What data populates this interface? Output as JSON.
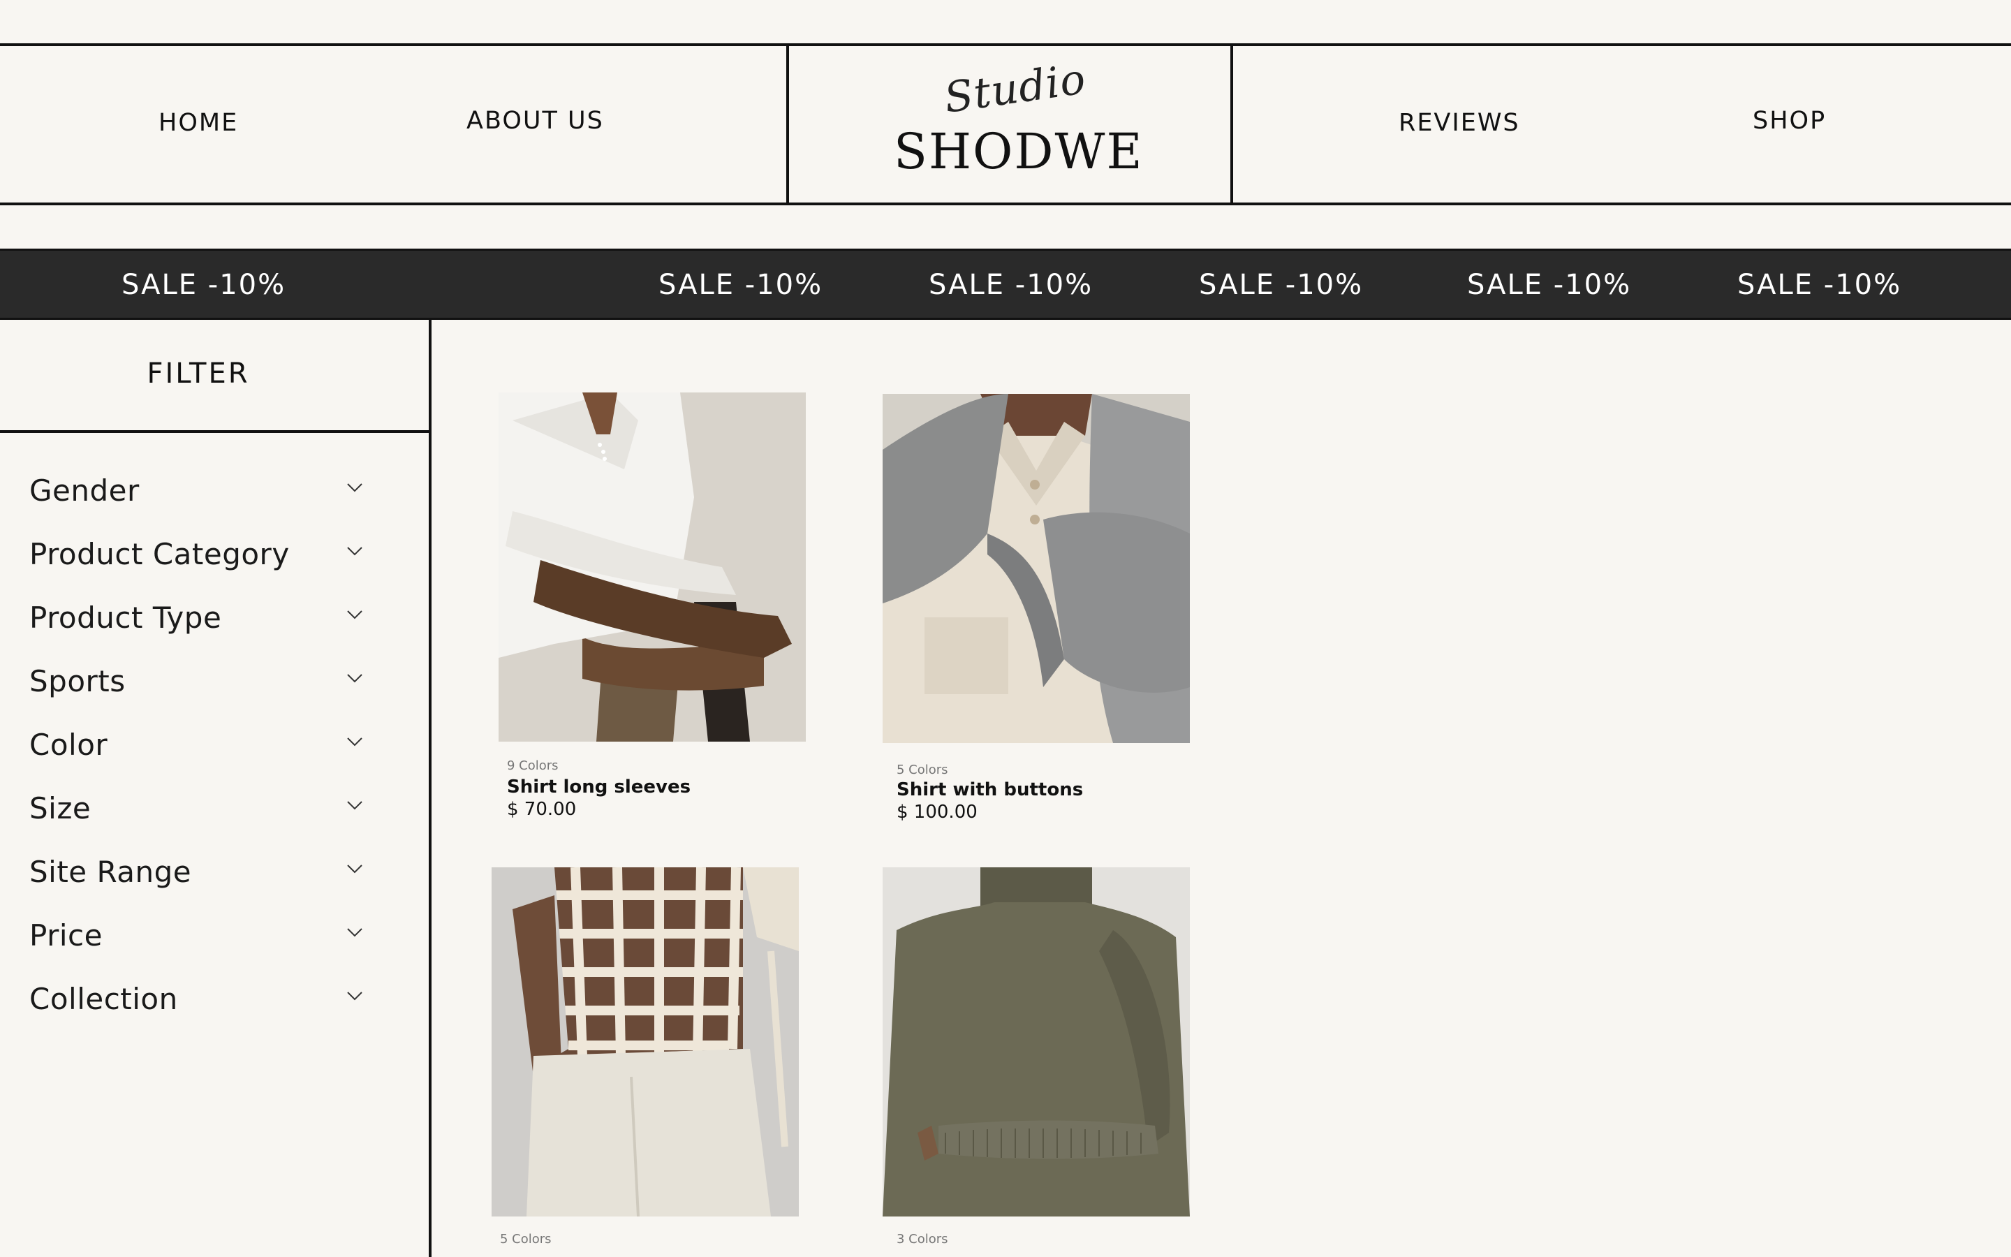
{
  "nav": {
    "home": "HOME",
    "about": "ABOUT US",
    "reviews": "REVIEWS",
    "shop": "SHOP"
  },
  "brand": {
    "script": "Studio",
    "name": "SHODWE"
  },
  "banner": {
    "items": [
      "SALE -10%",
      "SALE -10%",
      "SALE -10%",
      "SALE -10%",
      "SALE -10%",
      "SALE -10%"
    ]
  },
  "filter": {
    "title": "FILTER",
    "items": [
      {
        "label": "Gender"
      },
      {
        "label": "Product Category"
      },
      {
        "label": "Product Type"
      },
      {
        "label": "Sports"
      },
      {
        "label": "Color"
      },
      {
        "label": "Size"
      },
      {
        "label": "Site Range"
      },
      {
        "label": "Price"
      },
      {
        "label": "Collection"
      }
    ]
  },
  "products": [
    {
      "colors": "9 Colors",
      "name": "Shirt long sleeves",
      "price": "$ 70.00"
    },
    {
      "colors": "5 Colors",
      "name": "Shirt with buttons",
      "price": "$ 100.00"
    },
    {
      "colors": "5 Colors",
      "name": "",
      "price": ""
    },
    {
      "colors": "3 Colors",
      "name": "",
      "price": ""
    }
  ],
  "theme": {
    "background": "#f8f6f2",
    "banner": "#2a2a2a",
    "line": "#111111"
  }
}
